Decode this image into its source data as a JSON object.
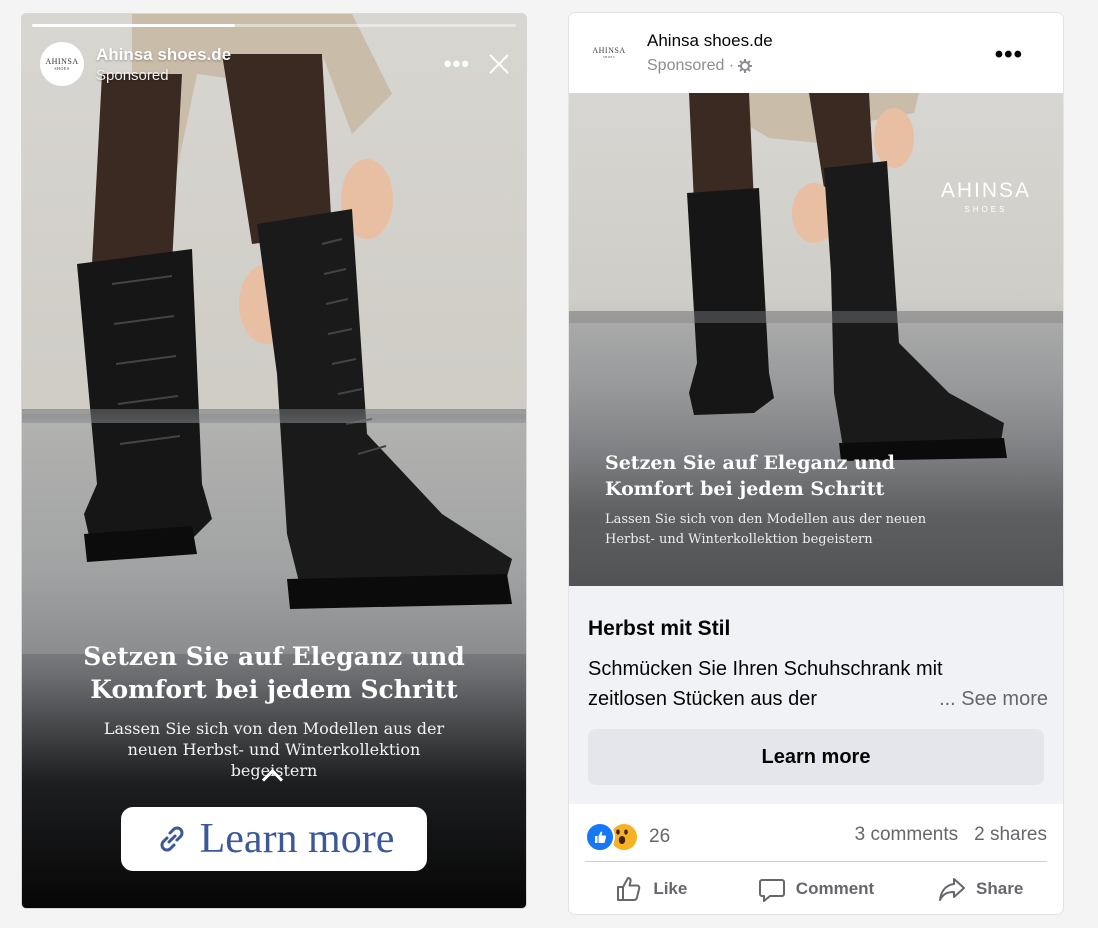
{
  "story": {
    "brand_name": "Ahinsa shoes.de",
    "sponsored": "Sponsored",
    "logo_line1": "AHINSA",
    "logo_line2": "SHOES",
    "more_label": "•••",
    "progress_fraction": 0.42,
    "headline": "Setzen Sie auf Eleganz und Komfort bei jedem Schritt",
    "subtext": "Lassen Sie sich von den Modellen aus der neuen Herbst- und Winterkollektion begeistern",
    "cta_label": "Learn more"
  },
  "feed": {
    "brand_name": "Ahinsa shoes.de",
    "sponsored": "Sponsored ·",
    "logo_line1": "AHINSA",
    "logo_line2": "SHOES",
    "more_label": "•••",
    "watermark_line1": "AHINSA",
    "watermark_line2": "SHOES",
    "image_headline": "Setzen Sie auf Eleganz und Komfort bei jedem Schritt",
    "image_subtext": "Lassen Sie sich von den Modellen aus der neuen Herbst- und Winterkollektion begeistern",
    "title": "Herbst mit Stil",
    "body_line1": "Schmücken Sie Ihren Schuhschrank mit",
    "body_line2": "zeitlosen Stücken aus der",
    "see_more": "... See more",
    "cta_label": "Learn more",
    "reaction_count": "26",
    "comments": "3 comments",
    "shares": "2 shares",
    "actions": {
      "like": "Like",
      "comment": "Comment",
      "share": "Share"
    }
  },
  "colors": {
    "facebook_blue": "#1877f2",
    "story_cta_text": "#3b5998",
    "muted_text": "#65676b",
    "feed_info_bg": "#f0f2f5"
  }
}
